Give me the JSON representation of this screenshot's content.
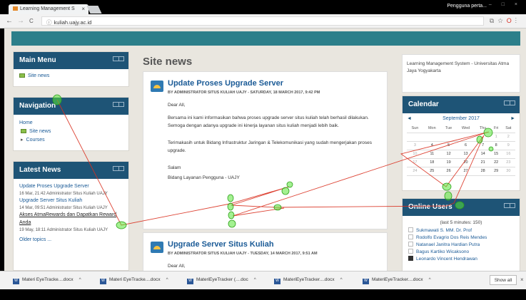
{
  "browser": {
    "tab_title": "Learning Management S",
    "tab_close": "×",
    "user_label": "Pengguna perta...",
    "window_controls": "– □ ×",
    "back": "←",
    "forward": "→",
    "reload": "C",
    "url": "kuliah.uajy.ac.id",
    "info_icon": "ⓘ"
  },
  "left": {
    "main_menu": {
      "title": "Main Menu",
      "items": [
        "Site news"
      ]
    },
    "navigation": {
      "title": "Navigation",
      "home": "Home",
      "items": [
        "Site news",
        "Courses"
      ]
    },
    "latest_news": {
      "title": "Latest News",
      "items": [
        {
          "title": "Update Proses Upgrade Server",
          "meta": "16 Mar, 21:42 Administrator Situs Kuliah UAJY"
        },
        {
          "title": "Upgrade Server Situs Kuliah",
          "meta": "14 Mar, 09:51 Administrator Situs Kuliah UAJY"
        },
        {
          "title": "Akses AtmaRewards dan Dapatkan Reward Anda",
          "meta": "19 May, 18:11 Administrator Situs Kuliah UAJY"
        }
      ],
      "older": "Older topics ..."
    }
  },
  "main": {
    "title": "Site news",
    "post1": {
      "title": "Update Proses Upgrade Server",
      "meta": "BY ADMINISTRATOR SITUS KULIAH UAJY - SATURDAY, 18 MARCH 2017, 9:42 PM",
      "greeting": "Dear All,",
      "para1": "Bersama ini kami informasikan bahwa proses upgrade server situs kuliah telah berhasil dilakukan. Semoga dengan adanya upgrade ini kinerja layanan situs kuliah menjadi lebih baik.",
      "para2": "Terimakasih untuk Bidang Infrastruktur Jaringan & Telekomunikasi yang sudah mengerjakan proses upgrade.",
      "closing": "Salam",
      "sign": "Bidang Layanan Pengguna - UAJY"
    },
    "post2": {
      "title": "Upgrade Server Situs Kuliah",
      "meta": "BY ADMINISTRATOR SITUS KULIAH UAJY - TUESDAY, 14 MARCH 2017, 9:51 AM",
      "greeting": "Dear All,"
    }
  },
  "right": {
    "info": "Learning Management System - Universitas Atma Jaya Yogyakarta",
    "calendar": {
      "title": "Calendar",
      "month": "September 2017",
      "prev": "◄",
      "next": "►",
      "days": [
        "Sun",
        "Mon",
        "Tue",
        "Wed",
        "Thu",
        "Fri",
        "Sat"
      ],
      "weeks": [
        [
          "",
          "",
          "",
          "",
          "",
          "1",
          "2"
        ],
        [
          "3",
          "4",
          "5",
          "6",
          "7",
          "8",
          "9"
        ],
        [
          "10",
          "11",
          "12",
          "13",
          "14",
          "15",
          "16"
        ],
        [
          "17",
          "18",
          "19",
          "20",
          "21",
          "22",
          "23"
        ],
        [
          "24",
          "25",
          "26",
          "27",
          "28",
          "29",
          "30"
        ]
      ]
    },
    "online": {
      "title": "Online Users",
      "subtitle": "(last 5 minutes: 150)",
      "users": [
        "Sukmawati S. MM. Dr. Prof",
        "Rodolfo Evagrio Dos Reis Mendes",
        "Natanael Janitra Hardian Putra",
        "Bagus Kartiko Wicaksono",
        "Leonardo Vincent Hendrawan"
      ]
    }
  },
  "downloads": {
    "items": [
      "Materi EyeTracke....docx",
      "Materi EyeTracke....docx",
      "MateriEyeTracker (....doc",
      "MateriEyeTracker....docx",
      "MateriEyeTracker....docx"
    ],
    "show_all": "Show all",
    "close": "×"
  },
  "colors": {
    "block_header": "#1e5476",
    "link": "#1a5a96",
    "top_band": "#2c7f8a",
    "gaze_line": "#d9301f",
    "fixation": "#57e637"
  }
}
